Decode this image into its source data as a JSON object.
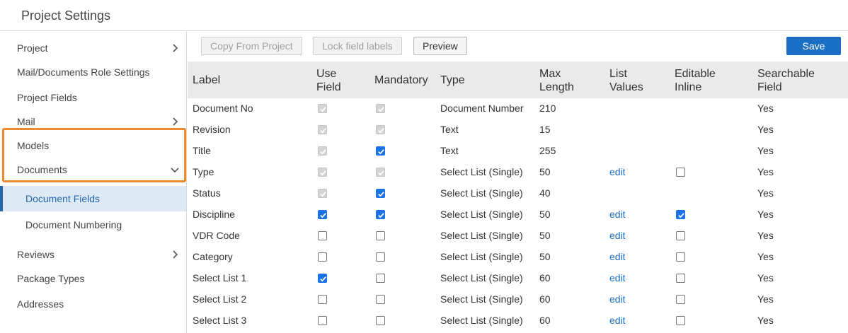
{
  "header": {
    "title": "Project Settings"
  },
  "sidebar": {
    "items": [
      {
        "label": "Project",
        "chevron": "right"
      },
      {
        "label": "Mail/Documents Role Settings",
        "chevron": ""
      },
      {
        "label": "Project Fields",
        "chevron": ""
      },
      {
        "label": "Mail",
        "chevron": "right"
      },
      {
        "label": "Models",
        "chevron": ""
      },
      {
        "label": "Documents",
        "chevron": "down"
      },
      {
        "label": "Document Fields",
        "chevron": "",
        "sub": true,
        "active": true
      },
      {
        "label": "Document Numbering",
        "chevron": "",
        "sub": true
      },
      {
        "label": "Reviews",
        "chevron": "right"
      },
      {
        "label": "Package Types",
        "chevron": ""
      },
      {
        "label": "Addresses",
        "chevron": ""
      }
    ]
  },
  "toolbar": {
    "copy_label": "Copy From Project",
    "lock_label": "Lock field labels",
    "preview_label": "Preview",
    "save_label": "Save"
  },
  "table": {
    "columns": [
      "Label",
      "Use Field",
      "Mandatory",
      "Type",
      "Max Length",
      "List Values",
      "Editable Inline",
      "Searchable Field"
    ],
    "column_lines": [
      [
        "Label"
      ],
      [
        "Use",
        "Field"
      ],
      [
        "Mandatory"
      ],
      [
        "Type"
      ],
      [
        "Max",
        "Length"
      ],
      [
        "List",
        "Values"
      ],
      [
        "Editable",
        "Inline"
      ],
      [
        "Searchable",
        "Field"
      ]
    ],
    "rows": [
      {
        "label": "Document No",
        "use_field": "checked-disabled",
        "mandatory": "checked-disabled",
        "type": "Document Number",
        "max_length": "210",
        "list_values": "",
        "editable_inline": "none",
        "searchable": "Yes"
      },
      {
        "label": "Revision",
        "use_field": "checked-disabled",
        "mandatory": "checked-disabled",
        "type": "Text",
        "max_length": "15",
        "list_values": "",
        "editable_inline": "none",
        "searchable": "Yes"
      },
      {
        "label": "Title",
        "use_field": "checked-disabled",
        "mandatory": "checked",
        "type": "Text",
        "max_length": "255",
        "list_values": "",
        "editable_inline": "none",
        "searchable": "Yes"
      },
      {
        "label": "Type",
        "use_field": "checked-disabled",
        "mandatory": "checked-disabled",
        "type": "Select List (Single)",
        "max_length": "50",
        "list_values": "edit",
        "editable_inline": "unchecked",
        "searchable": "Yes"
      },
      {
        "label": "Status",
        "use_field": "checked-disabled",
        "mandatory": "checked",
        "type": "Select List (Single)",
        "max_length": "40",
        "list_values": "",
        "editable_inline": "none",
        "searchable": "Yes"
      },
      {
        "label": "Discipline",
        "use_field": "checked",
        "mandatory": "checked",
        "type": "Select List (Single)",
        "max_length": "50",
        "list_values": "edit",
        "editable_inline": "checked",
        "searchable": "Yes"
      },
      {
        "label": "VDR Code",
        "use_field": "unchecked",
        "mandatory": "unchecked",
        "type": "Select List (Single)",
        "max_length": "50",
        "list_values": "edit",
        "editable_inline": "unchecked",
        "searchable": "Yes"
      },
      {
        "label": "Category",
        "use_field": "unchecked",
        "mandatory": "unchecked",
        "type": "Select List (Single)",
        "max_length": "50",
        "list_values": "edit",
        "editable_inline": "unchecked",
        "searchable": "Yes"
      },
      {
        "label": "Select List 1",
        "use_field": "checked",
        "mandatory": "unchecked",
        "type": "Select List (Single)",
        "max_length": "60",
        "list_values": "edit",
        "editable_inline": "unchecked",
        "searchable": "Yes"
      },
      {
        "label": "Select List 2",
        "use_field": "unchecked",
        "mandatory": "unchecked",
        "type": "Select List (Single)",
        "max_length": "60",
        "list_values": "edit",
        "editable_inline": "unchecked",
        "searchable": "Yes"
      },
      {
        "label": "Select List 3",
        "use_field": "unchecked",
        "mandatory": "unchecked",
        "type": "Select List (Single)",
        "max_length": "60",
        "list_values": "edit",
        "editable_inline": "unchecked",
        "searchable": "Yes"
      }
    ]
  },
  "colors": {
    "accent": "#1a6fc4",
    "highlight": "#ee8a2e",
    "active_bg": "#dde9f5"
  }
}
